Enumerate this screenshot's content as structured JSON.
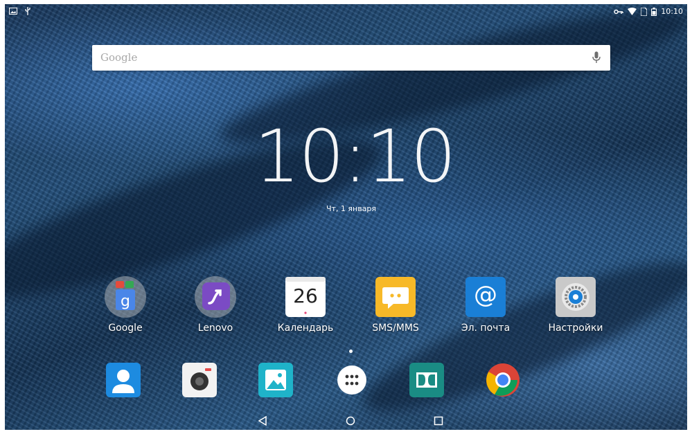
{
  "status_bar": {
    "time": "10:10",
    "left_icons": [
      "image-icon",
      "usb-icon"
    ],
    "right_icons": [
      "vpn-key-icon",
      "wifi-icon",
      "sim-icon",
      "battery-icon"
    ]
  },
  "search": {
    "logo": "Google",
    "mic_icon": "mic-icon"
  },
  "clock": {
    "time": "10:10",
    "date": "Чт, 1 января"
  },
  "apps": [
    {
      "name": "Google",
      "icon": "google-folder-icon"
    },
    {
      "name": "Lenovo",
      "icon": "lenovo-folder-icon"
    },
    {
      "name": "Календарь",
      "icon": "calendar-icon",
      "day": "26"
    },
    {
      "name": "SMS/MMS",
      "icon": "messaging-icon"
    },
    {
      "name": "Эл. почта",
      "icon": "email-icon",
      "glyph": "@"
    },
    {
      "name": "Настройки",
      "icon": "settings-icon"
    }
  ],
  "dock": [
    {
      "icon": "contacts-icon"
    },
    {
      "icon": "camera-icon"
    },
    {
      "icon": "gallery-icon"
    },
    {
      "icon": "all-apps-icon"
    },
    {
      "icon": "dolby-icon"
    },
    {
      "icon": "chrome-icon"
    }
  ],
  "nav": {
    "buttons": [
      "back-icon",
      "home-icon",
      "recents-icon"
    ]
  },
  "colors": {
    "wallpaper": "#24527f",
    "calendar_dot": "#e54a7a",
    "sms_yellow": "#f7b928",
    "email_blue": "#1a7fd6",
    "dolby_teal": "#1a8c84"
  }
}
